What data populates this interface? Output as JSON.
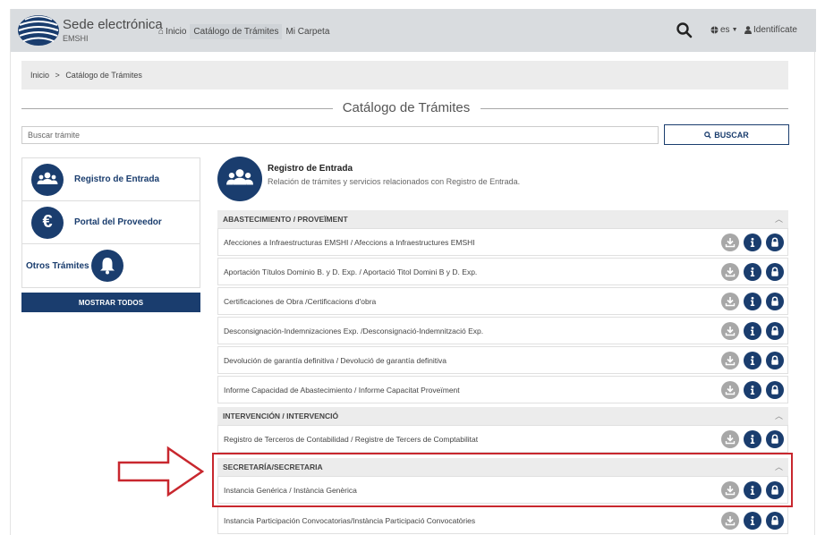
{
  "header": {
    "brand_title": "Sede electrónica",
    "brand_subtitle": "EMSHI",
    "nav": [
      {
        "label": "Inicio",
        "icon": "home-icon"
      },
      {
        "label": "Catálogo de Trámites"
      },
      {
        "label": "Mi Carpeta"
      }
    ],
    "lang_label": "es",
    "user_label": "Identifícate"
  },
  "breadcrumb": {
    "home": "Inicio",
    "separator": ">",
    "current": "Catálogo de Trámites"
  },
  "page_title": "Catálogo de Trámites",
  "search": {
    "placeholder": "Buscar trámite",
    "button_label": "BUSCAR"
  },
  "sidebar": {
    "items": [
      {
        "label": "Registro de Entrada",
        "icon": "users-icon"
      },
      {
        "label": "Portal del Proveedor",
        "icon": "euro-icon"
      },
      {
        "label": "Otros Trámites",
        "icon": "bell-icon"
      }
    ],
    "show_all_label": "MOSTRAR TODOS"
  },
  "main": {
    "title": "Registro de Entrada",
    "description": "Relación de trámites y servicios relacionados con Registro de Entrada.",
    "sections": [
      {
        "name": "ABASTECIMIENTO / PROVEÏMENT",
        "rows": [
          "Afecciones a Infraestructuras EMSHI / Afeccions a Infraestructures EMSHI",
          "Aportación Títulos Dominio B. y D. Exp. / Aportació Titol Domini B y D. Exp.",
          "Certificaciones de Obra /Certificacions d'obra",
          "Desconsignación-Indemnizaciones Exp. /Desconsignació-Indemnització Exp.",
          "Devolución de garantía definitiva / Devolució de garantía definitiva",
          "Informe Capacidad de Abastecimiento / Informe Capacitat Proveïment"
        ]
      },
      {
        "name": "INTERVENCIÓN / INTERVENCIÓ",
        "rows": [
          "Registro de Terceros de Contabilidad / Registre de Tercers de Comptabilitat"
        ]
      },
      {
        "name": "SECRETARÍA/SECRETARIA",
        "rows": [
          "Instancia Genérica / Instància Genèrica",
          "Instancia Participación Convocatorias/Instància Participació Convocatòries"
        ]
      }
    ]
  },
  "colors": {
    "primary": "#1a3d6e",
    "header_bg": "#d9dcdf",
    "highlight": "#c8272e",
    "download": "#a7a7a7"
  }
}
